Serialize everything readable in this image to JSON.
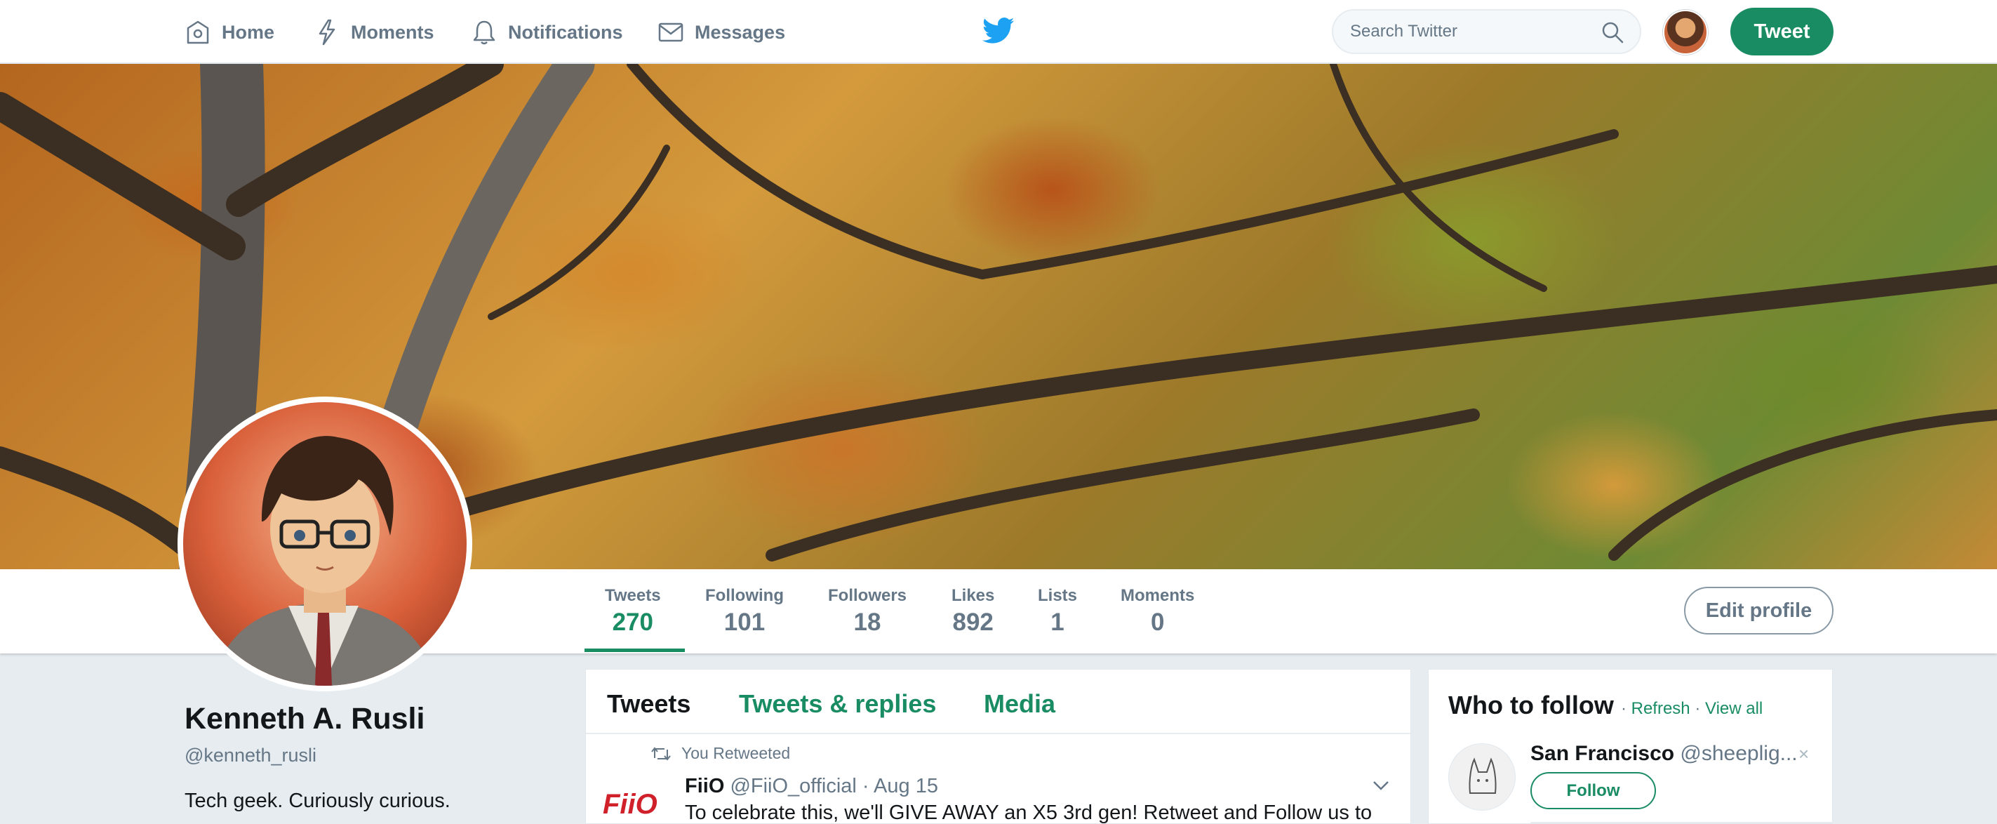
{
  "nav": {
    "items": [
      {
        "label": "Home",
        "icon": "home-icon"
      },
      {
        "label": "Moments",
        "icon": "lightning-icon"
      },
      {
        "label": "Notifications",
        "icon": "bell-icon"
      },
      {
        "label": "Messages",
        "icon": "envelope-icon"
      }
    ],
    "logo": "twitter-bird-icon",
    "search_placeholder": "Search Twitter",
    "tweet_button": "Tweet"
  },
  "colors": {
    "accent": "#1a8c64",
    "secondary_text": "#657786",
    "background": "#e6ecf0"
  },
  "profile": {
    "name": "Kenneth A. Rusli",
    "handle": "@kenneth_rusli",
    "bio": "Tech geek. Curiously curious.",
    "edit_button": "Edit profile"
  },
  "stats": [
    {
      "label": "Tweets",
      "value": "270"
    },
    {
      "label": "Following",
      "value": "101"
    },
    {
      "label": "Followers",
      "value": "18"
    },
    {
      "label": "Likes",
      "value": "892"
    },
    {
      "label": "Lists",
      "value": "1"
    },
    {
      "label": "Moments",
      "value": "0"
    }
  ],
  "timeline": {
    "tabs": [
      "Tweets",
      "Tweets & replies",
      "Media"
    ],
    "tweet": {
      "context": "You Retweeted",
      "author": "FiiO",
      "handle": "@FiiO_official",
      "date": "· Aug 15",
      "logo_text": "FiiO",
      "text": "To celebrate this, we'll GIVE AWAY an X5 3rd gen! Retweet and Follow us to"
    }
  },
  "who_to_follow": {
    "title": "Who to follow",
    "refresh": "Refresh",
    "view_all": "View all",
    "separator": "·",
    "suggestion": {
      "name": "San Francisco",
      "handle": "@sheeplig...",
      "follow": "Follow",
      "close": "×"
    }
  }
}
